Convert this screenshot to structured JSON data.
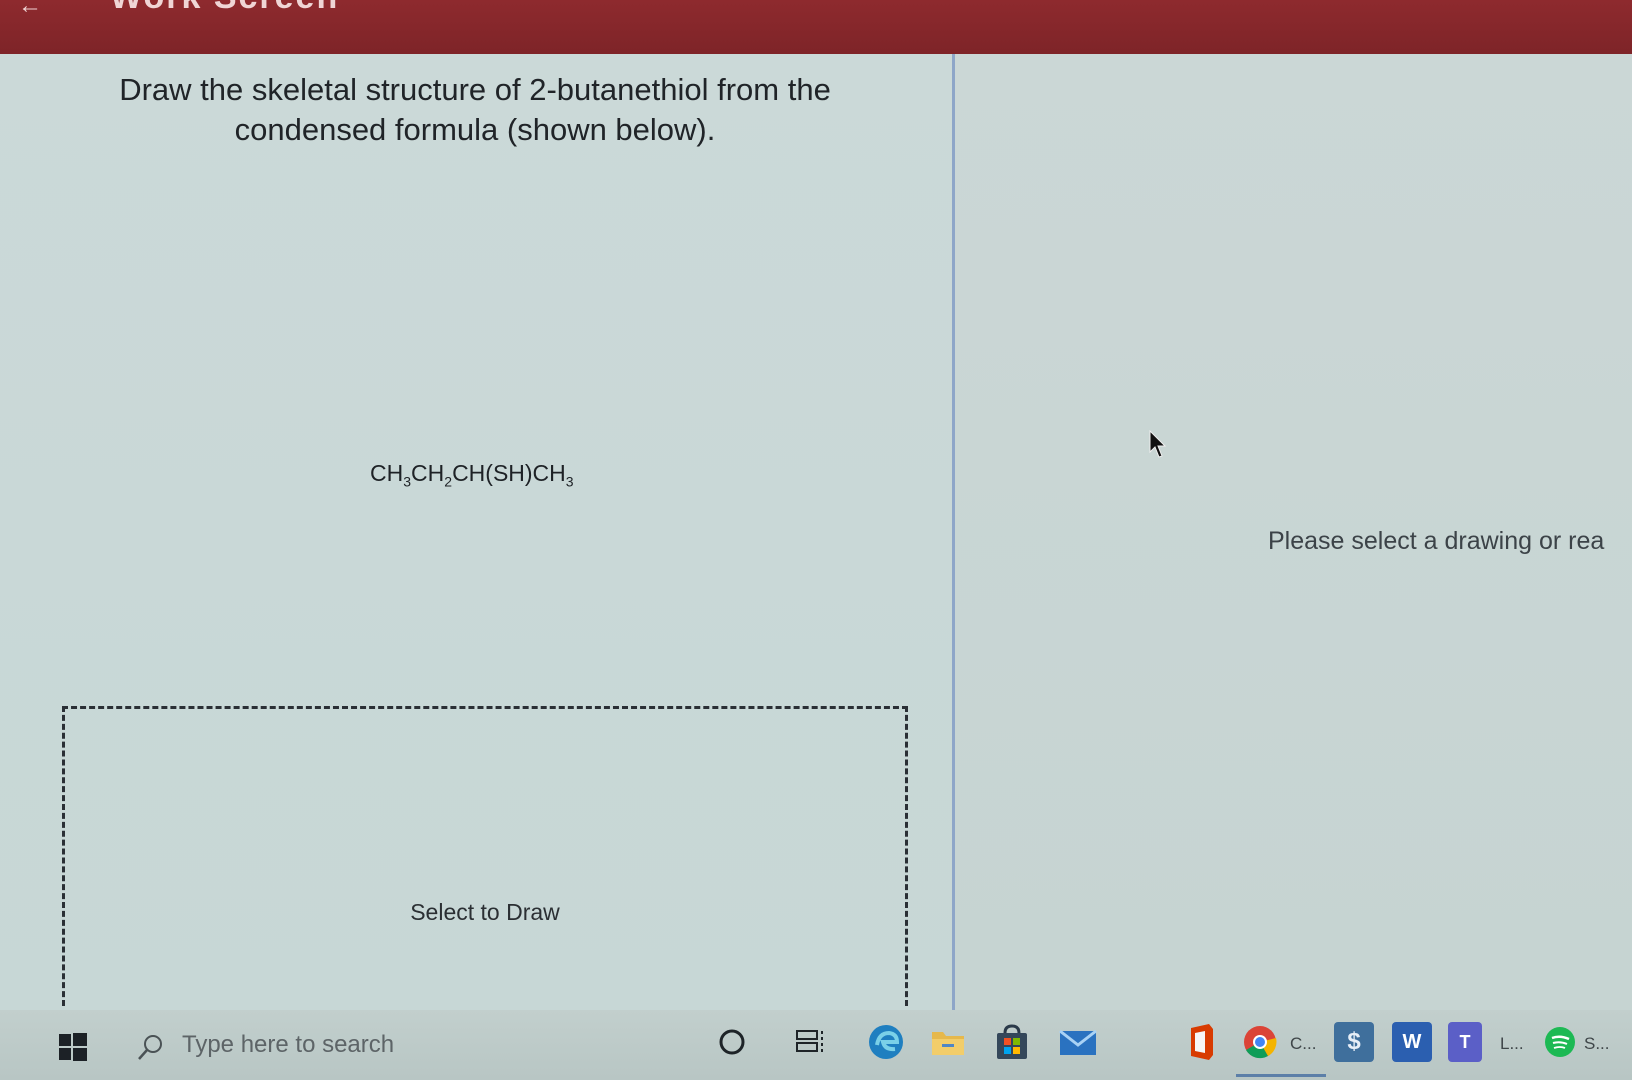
{
  "window": {
    "title": "Work Screen",
    "back_glyph": "←"
  },
  "question": {
    "text": "Draw the skeletal structure of 2-butanethiol from the condensed formula (shown below)."
  },
  "formula": {
    "parts": [
      "CH",
      "3",
      "CH",
      "2",
      "CH(SH)CH",
      "3"
    ]
  },
  "draw_area": {
    "label": "Select to Draw"
  },
  "right_panel": {
    "message": "Please select a drawing or rea"
  },
  "taskbar": {
    "search_placeholder": "Type here to search",
    "items": [
      {
        "name": "cortana-icon"
      },
      {
        "name": "task-view-icon"
      },
      {
        "name": "edge-icon"
      },
      {
        "name": "file-explorer-icon"
      },
      {
        "name": "store-icon"
      },
      {
        "name": "mail-icon"
      },
      {
        "name": "office-icon"
      },
      {
        "name": "chrome-icon",
        "label": "C..."
      },
      {
        "name": "app-s-icon"
      },
      {
        "name": "word-icon"
      },
      {
        "name": "teams-icon",
        "label": "L..."
      },
      {
        "name": "spotify-icon",
        "label": "S..."
      }
    ]
  },
  "colors": {
    "titlebar": "#8e2a2e",
    "divider": "#8ea6c8",
    "edge": "#1f7fc0",
    "word": "#2b5fb0",
    "teams": "#5b5fc7",
    "spotify": "#1db954",
    "office": "#d83b01"
  }
}
